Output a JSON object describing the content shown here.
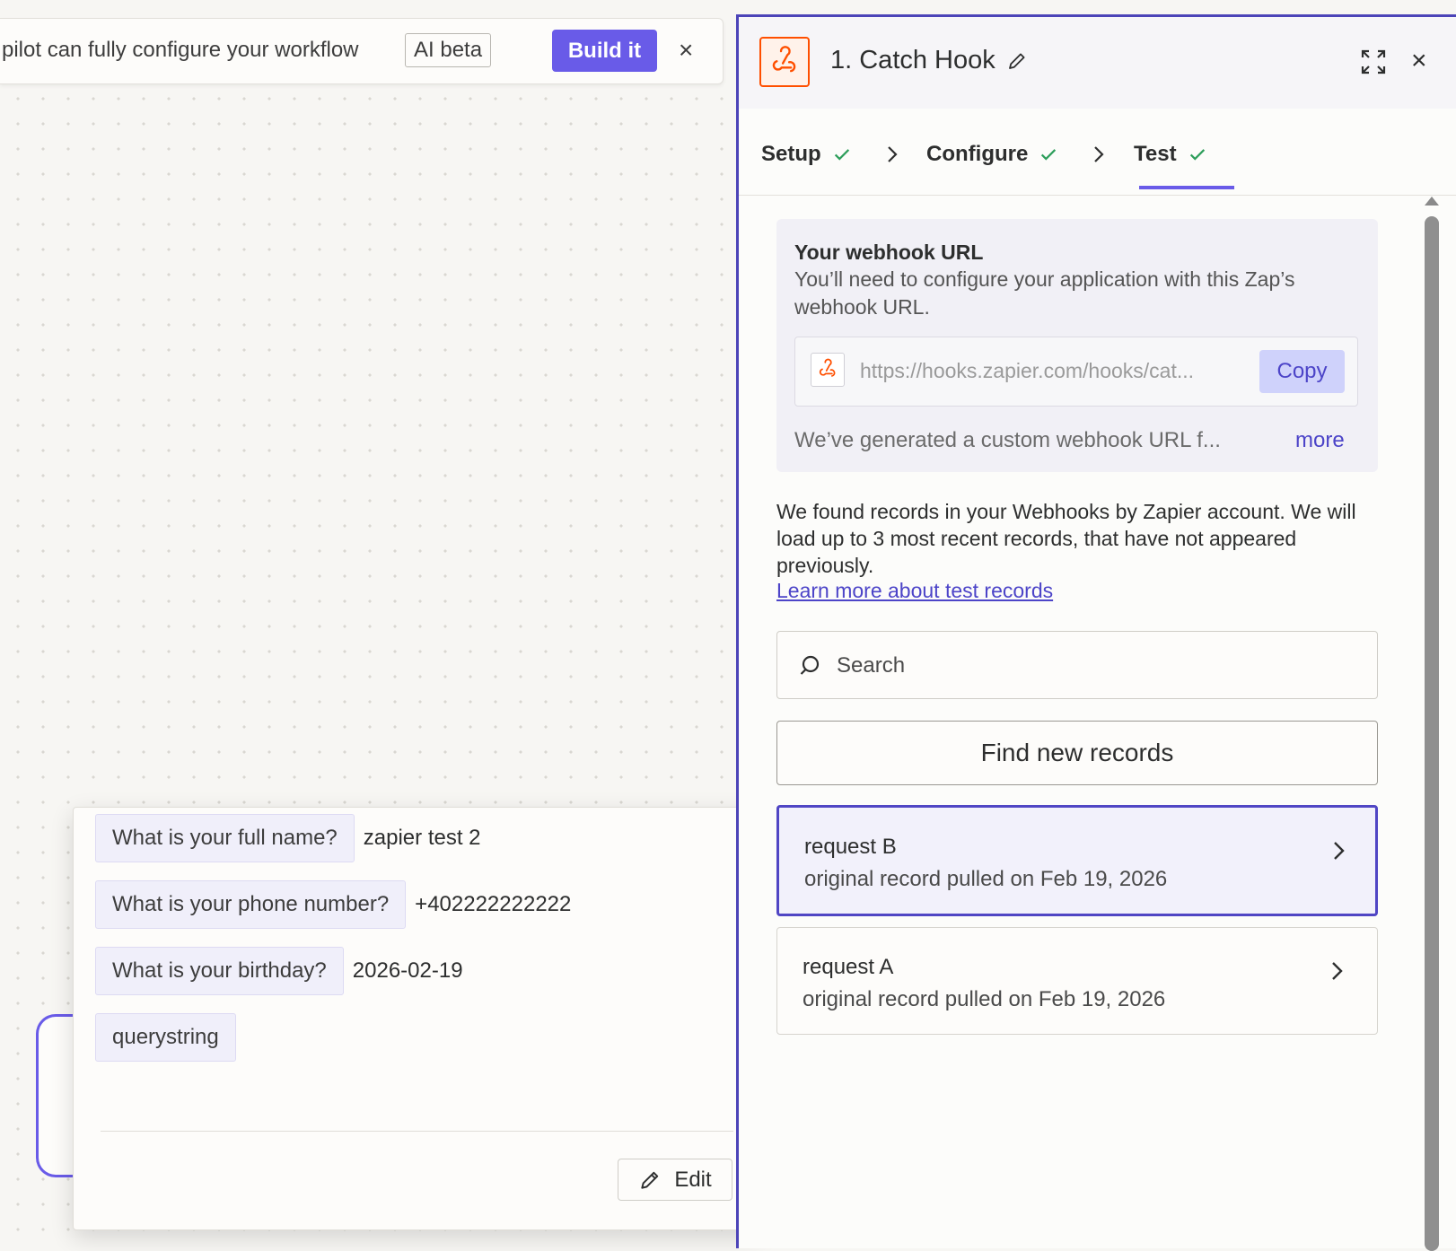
{
  "copilot_bar": {
    "text": "pilot can fully configure your workflow",
    "badge": "AI beta",
    "build_label": "Build it",
    "close_glyph": "×"
  },
  "preview": {
    "fields": [
      {
        "key": "What is your full name?",
        "value": "zapier test 2"
      },
      {
        "key": "What is your phone number?",
        "value": "+402222222222"
      },
      {
        "key": "What is your birthday?",
        "value": "2026-02-19"
      },
      {
        "key": "querystring",
        "value": ""
      }
    ],
    "edit_label": "Edit"
  },
  "panel": {
    "app_icon": "webhook-icon",
    "title": "1. Catch Hook",
    "close_glyph": "×",
    "tabs": [
      {
        "label": "Setup",
        "done": true
      },
      {
        "label": "Configure",
        "done": true
      },
      {
        "label": "Test",
        "done": true,
        "active": true
      }
    ],
    "webhook": {
      "title": "Your webhook URL",
      "description": "You’ll need to configure your application with this Zap’s webhook URL.",
      "url": "https://hooks.zapier.com/hooks/cat...",
      "copy_label": "Copy",
      "note": "We’ve generated a custom webhook URL f...",
      "more_label": "more"
    },
    "found_text": "We found records in your Webhooks by Zapier account. We will load up to 3 most recent records, that have not appeared previously.",
    "learn_link": "Learn more about test records",
    "search_placeholder": "Search",
    "find_button": "Find new records",
    "records": [
      {
        "title": "request B",
        "subtitle": "original record pulled on Feb 19, 2026",
        "selected": true
      },
      {
        "title": "request A",
        "subtitle": "original record pulled on Feb 19, 2026",
        "selected": false
      }
    ]
  },
  "colors": {
    "accent": "#695be8",
    "panel_border": "#4c44b8",
    "brand_orange": "#ff4f00",
    "check_green": "#2c9e5a",
    "link": "#4c44c8"
  }
}
